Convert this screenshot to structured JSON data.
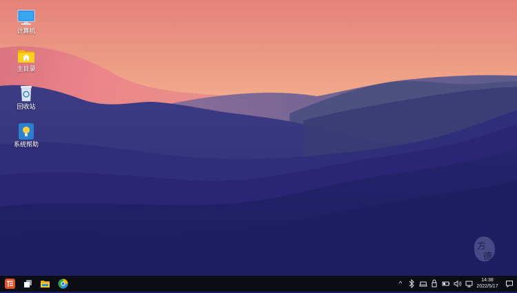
{
  "desktop": {
    "icons": [
      {
        "label": "计算机",
        "icon": "computer-icon"
      },
      {
        "label": "主目录",
        "icon": "home-folder-icon"
      },
      {
        "label": "回收站",
        "icon": "recycle-bin-icon"
      },
      {
        "label": "系统帮助",
        "icon": "help-bulb-icon"
      }
    ],
    "watermark": {
      "char1": "方",
      "char2": "德"
    }
  },
  "taskbar": {
    "start_icon": "start-menu-icon",
    "pinned": [
      {
        "icon": "multitask-view-icon"
      },
      {
        "icon": "file-manager-icon"
      },
      {
        "icon": "browser-icon"
      }
    ],
    "tray": {
      "expand": "^",
      "icons": [
        "bluetooth-icon",
        "drive-icon",
        "lock-icon",
        "battery-icon",
        "volume-icon",
        "network-icon"
      ]
    },
    "clock": {
      "time": "14:38",
      "date": "2022/5/17"
    },
    "notification_icon": "notification-icon"
  },
  "colors": {
    "sky_top": "#e98a78",
    "sky_mid": "#f5b48c",
    "deep_blue": "#1a1d63",
    "taskbar": "#0c0d14"
  }
}
